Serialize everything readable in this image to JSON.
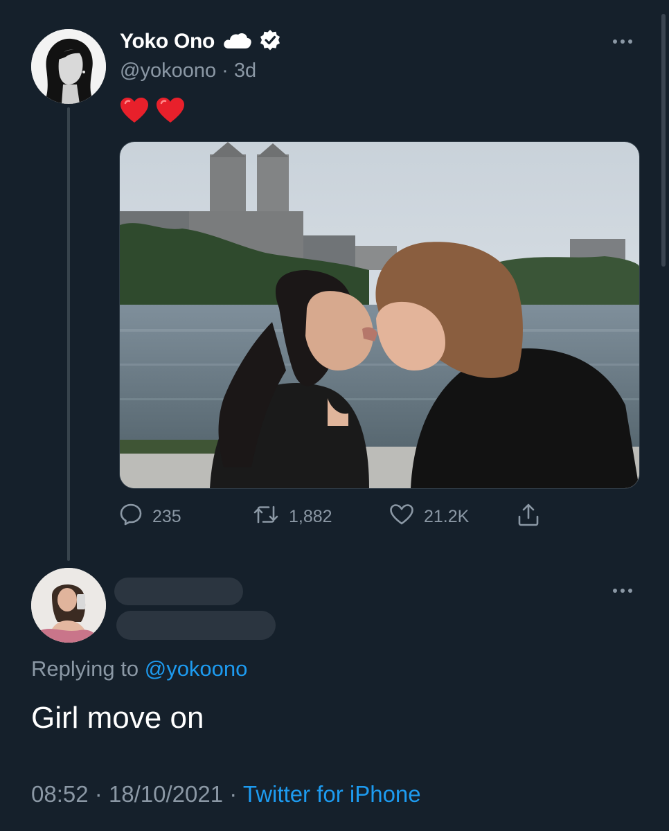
{
  "tweet": {
    "display_name": "Yoko Ono",
    "handle": "@yokoono",
    "separator": "·",
    "age": "3d",
    "text_emoji": "❤️❤️",
    "badges": [
      "cloud-icon",
      "verified-badge-icon"
    ],
    "photo_icon": "photo-of-couple-kissing-by-lake"
  },
  "actions": {
    "replies": "235",
    "retweets": "1,882",
    "likes": "21.2K"
  },
  "reply": {
    "replying_prefix": "Replying to ",
    "replying_handle": "@yokoono",
    "text": "Girl move on",
    "time": "08:52",
    "date": "18/10/2021",
    "separator": "·",
    "source": "Twitter for iPhone"
  },
  "colors": {
    "background": "#15202b",
    "secondary_text": "#8b98a5",
    "link": "#1d9bf0",
    "heart": "#e0245e"
  }
}
